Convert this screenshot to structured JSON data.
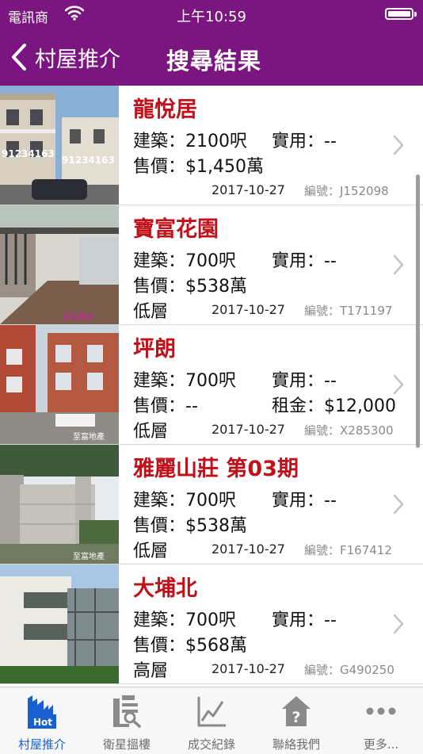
{
  "status_bar": {
    "carrier": "電訊商",
    "time": "上午10:59"
  },
  "nav": {
    "back_label": "村屋推介",
    "title": "搜尋結果"
  },
  "colors": {
    "accent": "#7b1680",
    "name_red": "#c0101a",
    "tab_active": "#1a5fcf"
  },
  "listings": [
    {
      "name": "龍悅居",
      "area": "建築：2100呎",
      "usable": "實用：--",
      "price": "售價：$1,450萬",
      "rent": "",
      "floor": "",
      "date": "2017-10-27",
      "code": "編號：J152098",
      "photo_overlay": "91234163"
    },
    {
      "name": "寶富花園",
      "area": "建築：700呎",
      "usable": "實用：--",
      "price": "售價：$538萬",
      "rent": "",
      "floor": "低層",
      "date": "2017-10-27",
      "code": "編號：T171197",
      "photo_overlay": "至富地產"
    },
    {
      "name": "坪朗",
      "area": "建築：700呎",
      "usable": "實用：--",
      "price": "售價：--",
      "rent": "租金：$12,000",
      "floor": "低層",
      "date": "2017-10-27",
      "code": "編號：X285300",
      "photo_overlay": "至富地產"
    },
    {
      "name": "雅麗山莊 第03期",
      "area": "建築：700呎",
      "usable": "實用：--",
      "price": "售價：$538萬",
      "rent": "",
      "floor": "低層",
      "date": "2017-10-27",
      "code": "編號：F167412",
      "photo_overlay": "至富地產"
    },
    {
      "name": "大埔北",
      "area": "建築：700呎",
      "usable": "實用：--",
      "price": "售價：$568萬",
      "rent": "",
      "floor": "高層",
      "date": "2017-10-27",
      "code": "編號：G490250",
      "photo_overlay": ""
    }
  ],
  "tabs": [
    {
      "label": "村屋推介",
      "icon": "hot-buildings-icon",
      "active": true
    },
    {
      "label": "衛星搵樓",
      "icon": "satellite-search-icon",
      "active": false
    },
    {
      "label": "成交紀錄",
      "icon": "line-chart-icon",
      "active": false
    },
    {
      "label": "聯絡我們",
      "icon": "house-question-icon",
      "active": false
    },
    {
      "label": "更多...",
      "icon": "more-dots-icon",
      "active": false
    }
  ]
}
